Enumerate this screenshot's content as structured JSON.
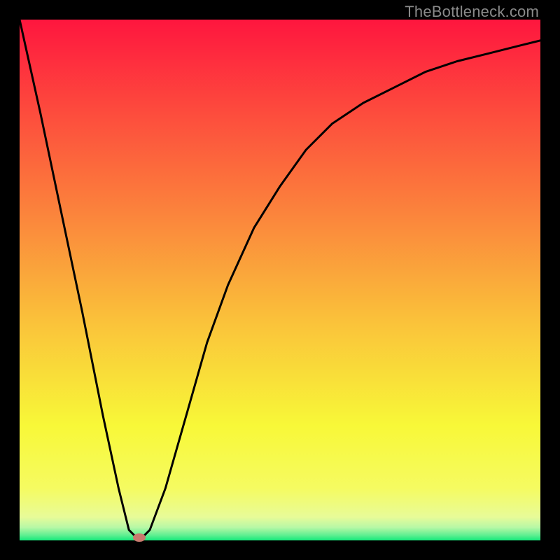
{
  "watermark": "TheBottleneck.com",
  "chart_data": {
    "type": "line",
    "title": "",
    "xlabel": "",
    "ylabel": "",
    "x": [
      0.0,
      0.04,
      0.08,
      0.12,
      0.16,
      0.19,
      0.21,
      0.23,
      0.25,
      0.28,
      0.32,
      0.36,
      0.4,
      0.45,
      0.5,
      0.55,
      0.6,
      0.66,
      0.72,
      0.78,
      0.84,
      0.9,
      0.96,
      1.0
    ],
    "values": [
      1.0,
      0.82,
      0.63,
      0.44,
      0.24,
      0.1,
      0.02,
      0.0,
      0.02,
      0.1,
      0.24,
      0.38,
      0.49,
      0.6,
      0.68,
      0.75,
      0.8,
      0.84,
      0.87,
      0.9,
      0.92,
      0.935,
      0.95,
      0.96
    ],
    "xlim": [
      0,
      1
    ],
    "ylim": [
      0,
      1
    ],
    "marker": {
      "x": 0.23,
      "y": 0.0
    },
    "background_gradient": {
      "type": "vertical",
      "stops": [
        {
          "pos": 0.0,
          "color": "#fe163e"
        },
        {
          "pos": 0.18,
          "color": "#fd4c3d"
        },
        {
          "pos": 0.38,
          "color": "#fb863c"
        },
        {
          "pos": 0.58,
          "color": "#fac23a"
        },
        {
          "pos": 0.78,
          "color": "#f8f838"
        },
        {
          "pos": 0.9,
          "color": "#f5fb61"
        },
        {
          "pos": 0.955,
          "color": "#e8fb98"
        },
        {
          "pos": 0.975,
          "color": "#b7f8a6"
        },
        {
          "pos": 0.99,
          "color": "#5fef91"
        },
        {
          "pos": 1.0,
          "color": "#16e97a"
        }
      ]
    }
  }
}
